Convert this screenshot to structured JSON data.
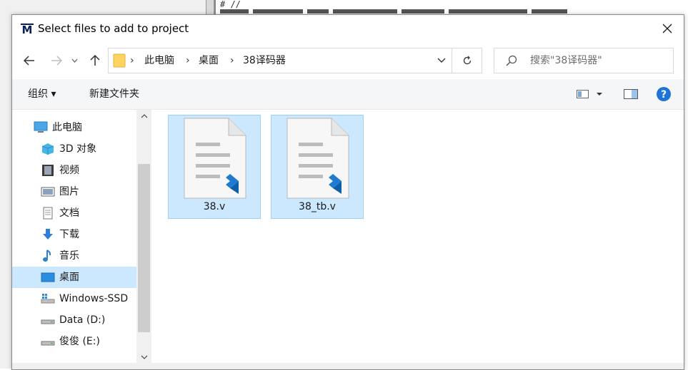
{
  "dialog": {
    "title": "Select files to add to project",
    "logo_letter": "M"
  },
  "background": {
    "code_line": "# //"
  },
  "address": {
    "crumbs": [
      "此电脑",
      "桌面",
      "38译码器"
    ]
  },
  "search": {
    "placeholder": "搜索\"38译码器\""
  },
  "toolbar": {
    "organize": "组织 ▾",
    "new_folder": "新建文件夹"
  },
  "sidebar": {
    "items": [
      {
        "label": "此电脑",
        "icon": "computer-icon"
      },
      {
        "label": "3D 对象",
        "icon": "cube-icon"
      },
      {
        "label": "视频",
        "icon": "film-icon"
      },
      {
        "label": "图片",
        "icon": "picture-icon"
      },
      {
        "label": "文档",
        "icon": "document-icon"
      },
      {
        "label": "下载",
        "icon": "download-arrow-icon"
      },
      {
        "label": "音乐",
        "icon": "music-note-icon"
      },
      {
        "label": "桌面",
        "icon": "desktop-icon"
      },
      {
        "label": "Windows-SSD",
        "icon": "drive-windows-icon"
      },
      {
        "label": "Data (D:)",
        "icon": "drive-icon"
      },
      {
        "label": "俊俊 (E:)",
        "icon": "drive-icon"
      }
    ]
  },
  "files": [
    {
      "name": "38.v",
      "icon": "vscode-file-icon"
    },
    {
      "name": "38_tb.v",
      "icon": "vscode-file-icon"
    }
  ],
  "colors": {
    "selection": "#cce8ff",
    "selection_border": "#99d1ff",
    "help_blue": "#1e73d8",
    "vscode_blue": "#1f7ad0"
  }
}
